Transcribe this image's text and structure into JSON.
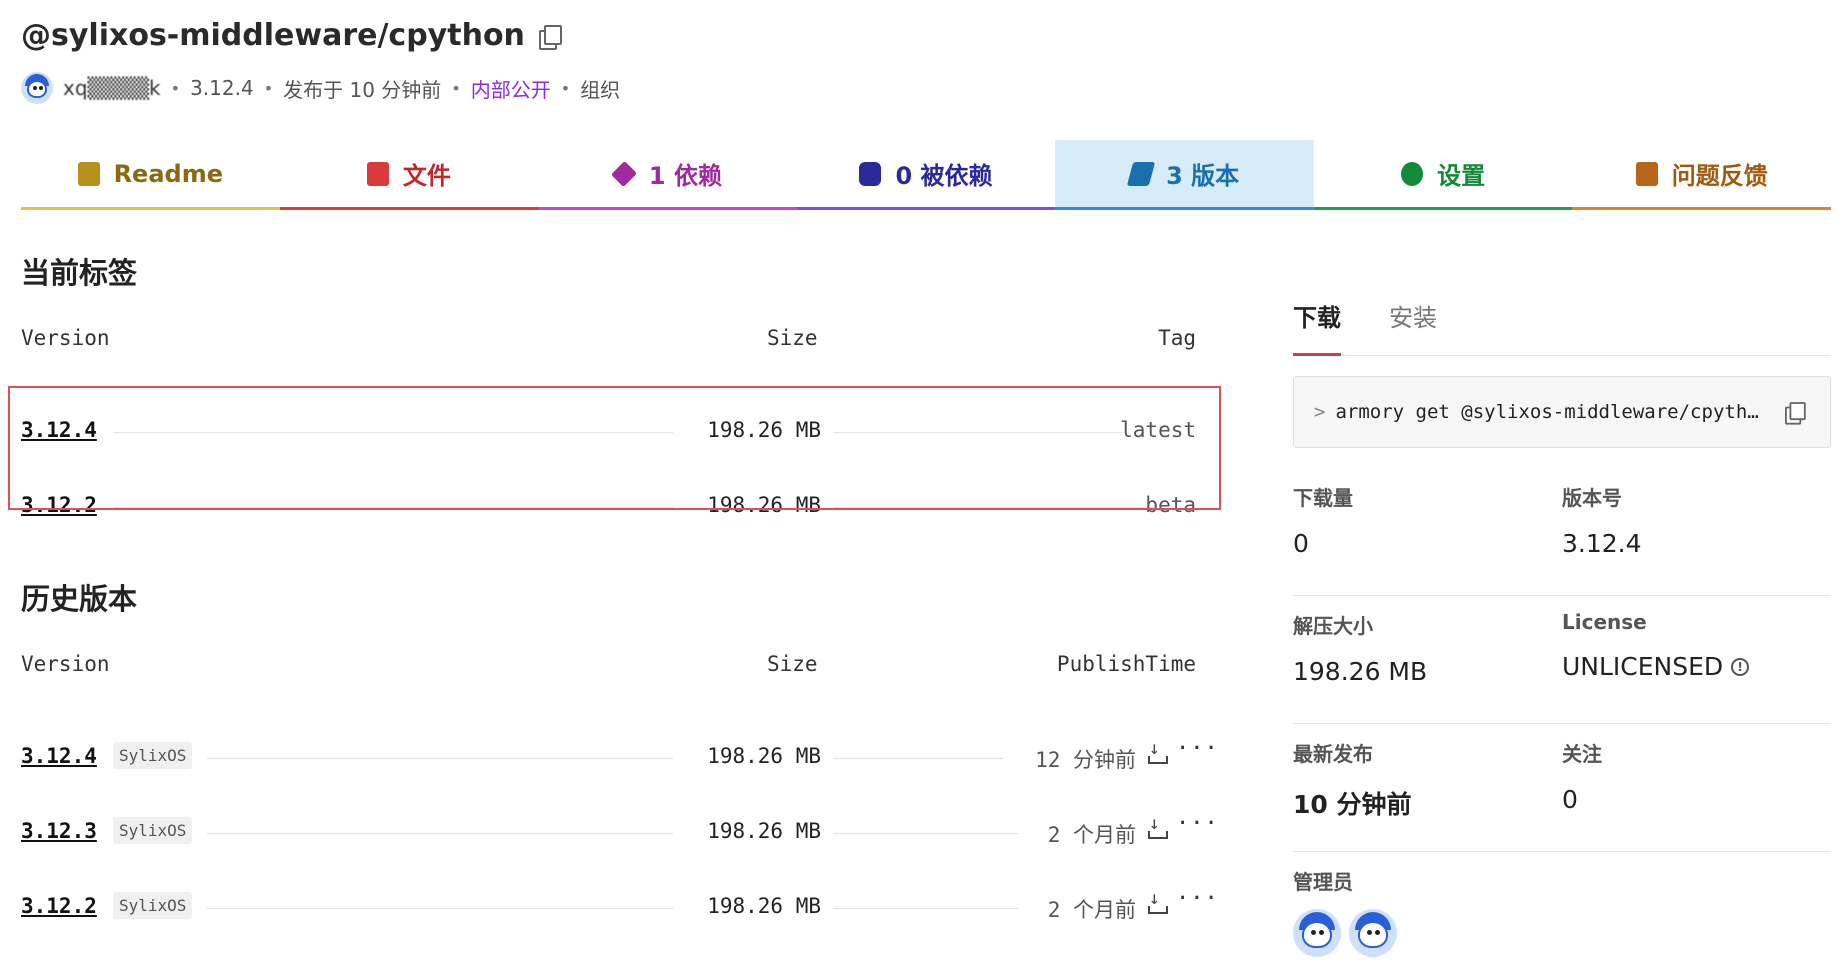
{
  "header": {
    "title": "@sylixos-middleware/cpython",
    "user": "xq▒▒▒▒k",
    "version": "3.12.4",
    "published": "发布于 10 分钟前",
    "visibility": "内部公开",
    "owner_type": "组织"
  },
  "tabs": [
    {
      "label": "Readme",
      "color": "#c8a02a",
      "icon": "readme-icon"
    },
    {
      "label": "文件",
      "color": "#d83b3b",
      "icon": "file-code-icon"
    },
    {
      "label": "1 依赖",
      "color": "#c040c0",
      "icon": "cube-icon"
    },
    {
      "label": "0 被依赖",
      "color": "#6a3fe0",
      "icon": "cubes-icon"
    },
    {
      "label": "3 版本",
      "color": "#2a8fd8",
      "icon": "tags-icon"
    },
    {
      "label": "设置",
      "color": "#1aa34a",
      "icon": "gear-icon"
    },
    {
      "label": "问题反馈",
      "color": "#c8782a",
      "icon": "issue-icon"
    }
  ],
  "current_tags": {
    "title": "当前标签",
    "headers": {
      "version": "Version",
      "size": "Size",
      "tag": "Tag"
    },
    "rows": [
      {
        "version": "3.12.4",
        "size": "198.26 MB",
        "tag": "latest"
      },
      {
        "version": "3.12.2",
        "size": "198.26 MB",
        "tag": "beta"
      }
    ]
  },
  "history": {
    "title": "历史版本",
    "headers": {
      "version": "Version",
      "size": "Size",
      "time": "PublishTime"
    },
    "rows": [
      {
        "version": "3.12.4",
        "os": "SylixOS",
        "size": "198.26 MB",
        "time": "12 分钟前"
      },
      {
        "version": "3.12.3",
        "os": "SylixOS",
        "size": "198.26 MB",
        "time": "2 个月前"
      },
      {
        "version": "3.12.2",
        "os": "SylixOS",
        "size": "198.26 MB",
        "time": "2 个月前"
      }
    ]
  },
  "side": {
    "tab_download": "下载",
    "tab_install": "安装",
    "command_prompt": ">",
    "command": "armory get @sylixos-middleware/cpyth…",
    "downloads_label": "下载量",
    "downloads_value": "0",
    "version_label": "版本号",
    "version_value": "3.12.4",
    "unpacked_label": "解压大小",
    "unpacked_value": "198.26 MB",
    "license_label": "License",
    "license_value": "UNLICENSED",
    "latest_label": "最新发布",
    "latest_value": "10 分钟前",
    "follow_label": "关注",
    "follow_value": "0",
    "admins_label": "管理员"
  }
}
